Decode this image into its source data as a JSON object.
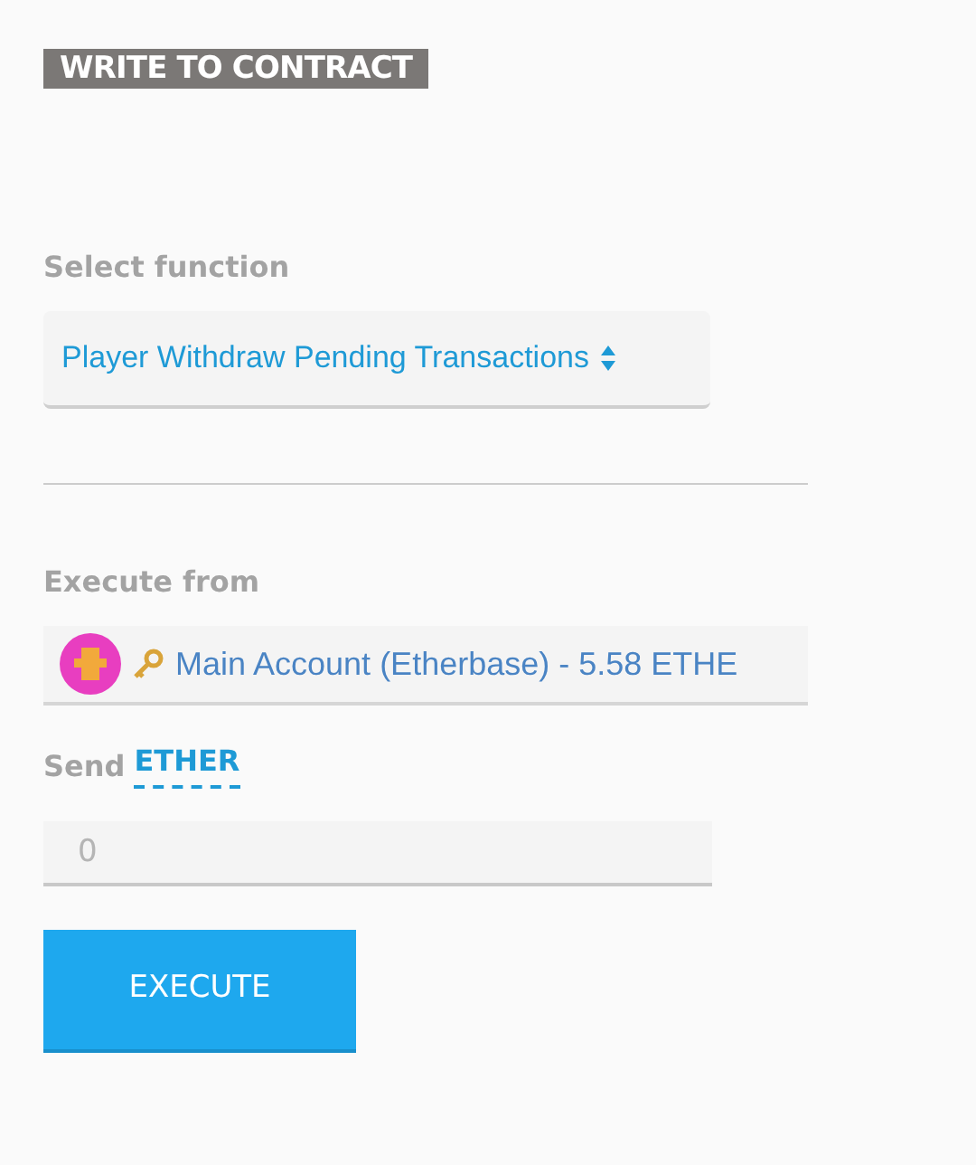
{
  "section_title": "WRITE TO CONTRACT",
  "function_select": {
    "label": "Select function",
    "value": "Player Withdraw Pending Transactions"
  },
  "execute_from": {
    "label": "Execute from",
    "account": "Main Account (Etherbase) - 5.58 ETHE"
  },
  "send": {
    "label": "Send",
    "unit": "ETHER",
    "placeholder": "0"
  },
  "buttons": [
    "EXECUTE"
  ]
}
